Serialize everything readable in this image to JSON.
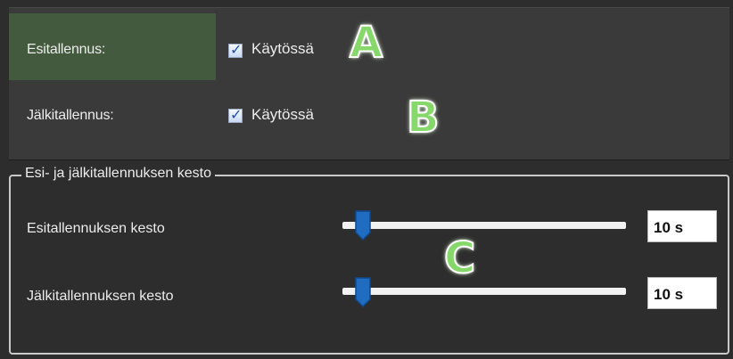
{
  "colors": {
    "background": "#2d2d2d",
    "panel": "#3a3a3a",
    "highlight": "#435a3e",
    "slider_handle": "#1f6cc0",
    "annotation": "#86d86a"
  },
  "settings": {
    "pre_recording": {
      "label": "Esitallennus:",
      "checkbox_label": "Käytössä",
      "checked": true
    },
    "post_recording": {
      "label": "Jälkitallennus:",
      "checkbox_label": "Käytössä",
      "checked": true
    }
  },
  "duration_group": {
    "title": "Esi- ja jälkitallennuksen kesto",
    "sliders": [
      {
        "label": "Esitallennuksen kesto",
        "value": "10 s",
        "fraction": 0.06
      },
      {
        "label": "Jälkitallennuksen kesto",
        "value": "10 s",
        "fraction": 0.06
      }
    ]
  },
  "annotations": {
    "a": "A",
    "b": "B",
    "c": "C"
  }
}
